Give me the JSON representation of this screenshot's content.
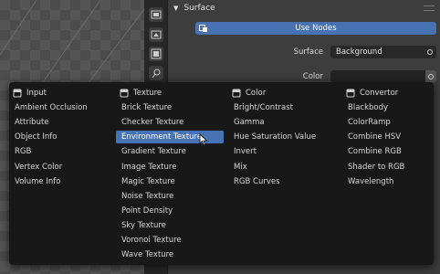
{
  "panel": {
    "title": "Surface",
    "use_nodes_label": "Use Nodes",
    "surface_label": "Surface",
    "surface_value": "Background",
    "color_label": "Color"
  },
  "tabs": [
    "render-tab",
    "output-tab",
    "view-layer-tab",
    "scene-tab",
    "world-tab"
  ],
  "menu": {
    "columns": [
      {
        "title": "Input",
        "icon": "socket-icon",
        "items": [
          "Ambient Occlusion",
          "Attribute",
          "Object Info",
          "RGB",
          "Vertex Color",
          "Volume Info"
        ]
      },
      {
        "title": "Texture",
        "icon": "socket-icon",
        "items": [
          "Brick Texture",
          "Checker Texture",
          "Environment Texture",
          "Gradient Texture",
          "Image Texture",
          "Magic Texture",
          "Noise Texture",
          "Point Density",
          "Sky Texture",
          "Voronoi Texture",
          "Wave Texture"
        ]
      },
      {
        "title": "Color",
        "icon": "socket-icon",
        "items": [
          "Bright/Contrast",
          "Gamma",
          "Hue Saturation Value",
          "Invert",
          "Mix",
          "RGB Curves"
        ]
      },
      {
        "title": "Convertor",
        "icon": "socket-icon",
        "items": [
          "Blackbody",
          "ColorRamp",
          "Combine HSV",
          "Combine RGB",
          "Shader to RGB",
          "Wavelength"
        ]
      }
    ],
    "highlighted": "Environment Texture"
  },
  "colors": {
    "accent": "#4772b3",
    "menu_bg": "#181818",
    "panel_bg": "#3d3d3d"
  }
}
